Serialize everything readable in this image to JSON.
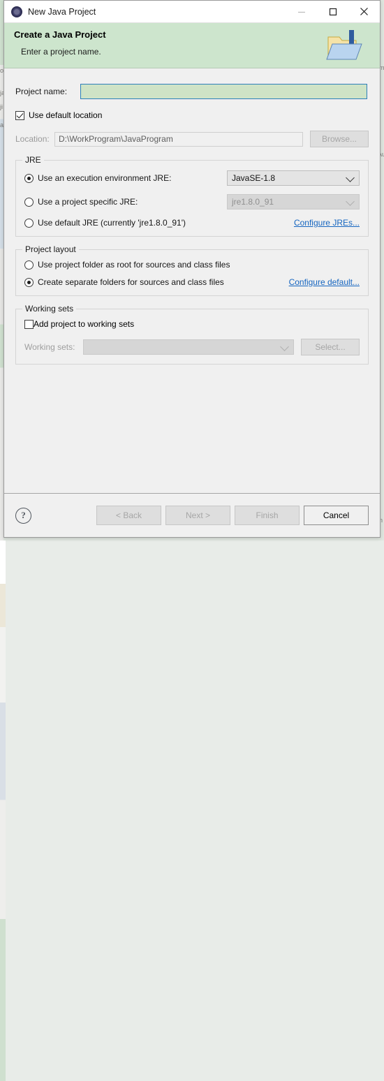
{
  "window": {
    "title": "New Java Project",
    "icon": "eclipse-icon",
    "controls": {
      "minimize": "minimize-icon",
      "maximize": "maximize-icon",
      "close": "close-icon"
    }
  },
  "banner": {
    "title": "Create a Java Project",
    "subtitle": "Enter a project name.",
    "icon": "java-project-folder-icon",
    "background_color": "#cde5cd"
  },
  "project_name": {
    "label": "Project name:",
    "value": "",
    "placeholder": ""
  },
  "location": {
    "use_default_label": "Use default location",
    "use_default_checked": true,
    "label": "Location:",
    "value": "D:\\WorkProgram\\JavaProgram",
    "browse_label": "Browse...",
    "browse_enabled": false
  },
  "jre": {
    "legend": "JRE",
    "options": [
      {
        "label": "Use an execution environment JRE:",
        "selected": true,
        "combo_value": "JavaSE-1.8",
        "combo_enabled": true
      },
      {
        "label": "Use a project specific JRE:",
        "selected": false,
        "combo_value": "jre1.8.0_91",
        "combo_enabled": false
      },
      {
        "label": "Use default JRE (currently 'jre1.8.0_91')",
        "selected": false
      }
    ],
    "configure_link": "Configure JREs..."
  },
  "project_layout": {
    "legend": "Project layout",
    "options": [
      {
        "label": "Use project folder as root for sources and class files",
        "selected": false
      },
      {
        "label": "Create separate folders for sources and class files",
        "selected": true
      }
    ],
    "configure_link": "Configure default..."
  },
  "working_sets": {
    "legend": "Working sets",
    "add_label": "Add project to working sets",
    "add_checked": false,
    "label": "Working sets:",
    "value": "",
    "select_label": "Select...",
    "select_enabled": false
  },
  "footer": {
    "help_glyph": "?",
    "back_label": "< Back",
    "back_enabled": false,
    "next_label": "Next >",
    "next_enabled": false,
    "finish_label": "Finish",
    "finish_enabled": false,
    "cancel_label": "Cancel",
    "cancel_enabled": true
  },
  "colors": {
    "banner": "#cde5cd",
    "focus_border": "#2980b9",
    "input_fill": "#cfe3c6",
    "link": "#1565c0",
    "dialog_bg": "#f0f0f0"
  },
  "backdrop": {
    "fragments": [
      "os",
      "ja",
      "ji",
      "at",
      "m",
      "n",
      "Au"
    ]
  }
}
